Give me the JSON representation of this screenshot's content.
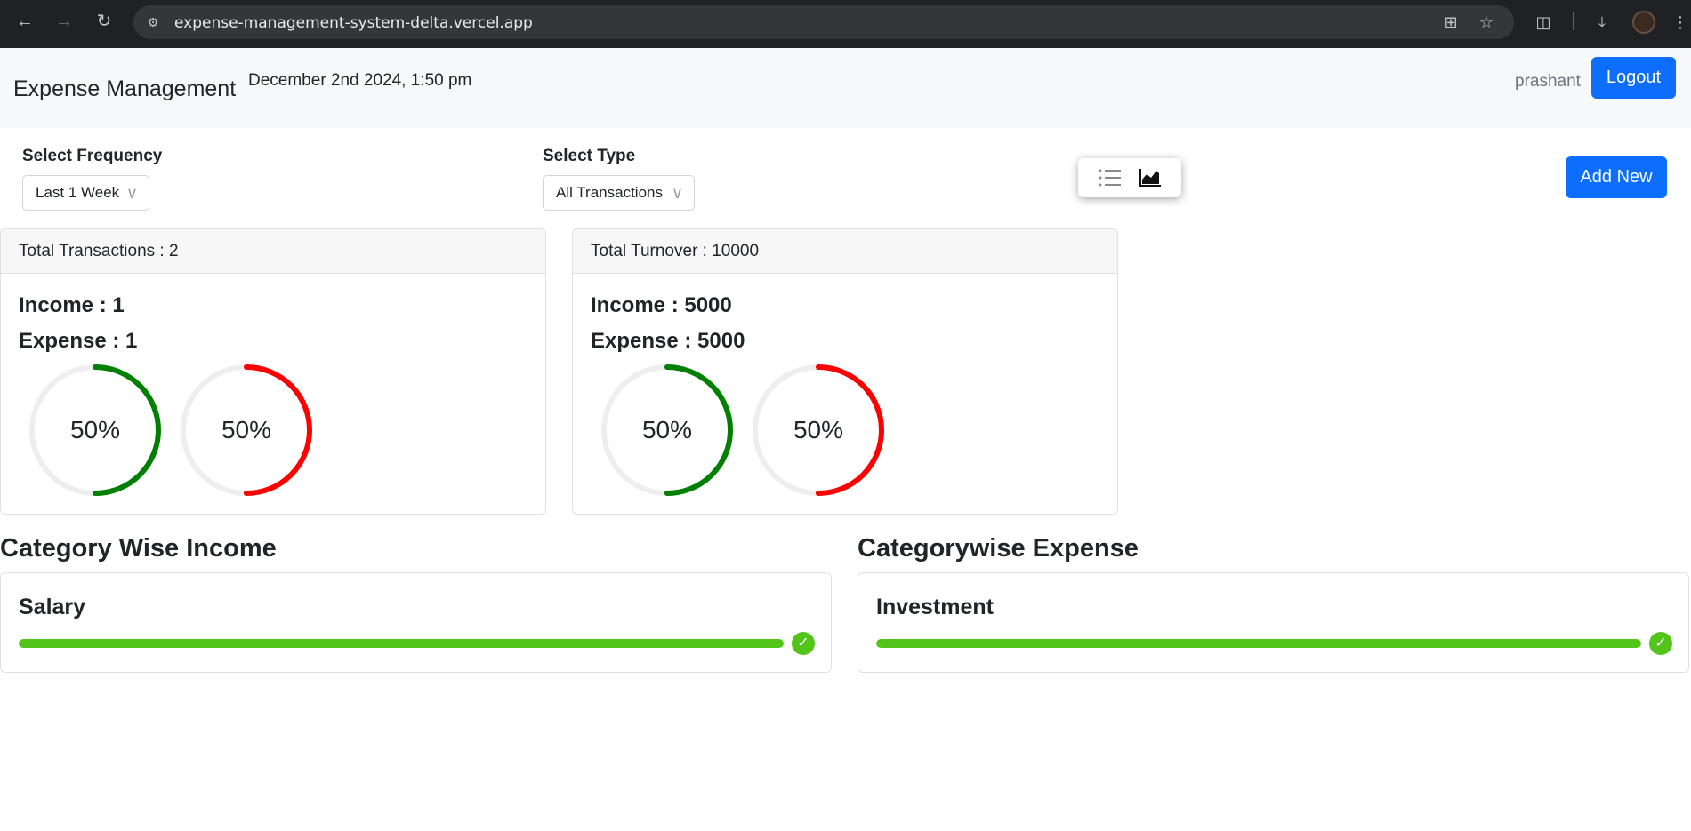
{
  "browser": {
    "url": "expense-management-system-delta.vercel.app",
    "icons": [
      "back-icon",
      "forward-icon",
      "reload-icon",
      "site-settings-icon",
      "install-app-icon",
      "bookmark-star-icon",
      "extensions-icon",
      "download-icon",
      "profile-avatar",
      "more-menu-icon"
    ]
  },
  "header": {
    "brand": "Expense Management",
    "date": "December 2nd 2024, 1:50 pm",
    "username": "prashant",
    "logout_label": "Logout"
  },
  "filters": {
    "frequency_label": "Select Frequency",
    "frequency_value": "Last 1 Week",
    "type_label": "Select Type",
    "type_value": "All Transactions",
    "add_label": "Add New",
    "view_icons": [
      "list-view-icon",
      "chart-view-icon"
    ]
  },
  "summary": {
    "transactions": {
      "header": "Total Transactions : 2",
      "income": "Income : 1",
      "expense": "Expense : 1",
      "income_percent": 50,
      "expense_percent": 50,
      "income_percent_label": "50%",
      "expense_percent_label": "50%"
    },
    "turnover": {
      "header": "Total Turnover : 10000",
      "income": "Income : 5000",
      "expense": "Expense : 5000",
      "income_percent": 50,
      "expense_percent": 50,
      "income_percent_label": "50%",
      "expense_percent_label": "50%"
    }
  },
  "categories": {
    "income_title": "Category Wise Income",
    "expense_title": "Categorywise Expense",
    "income_items": [
      {
        "name": "Salary",
        "percent": 100
      }
    ],
    "expense_items": [
      {
        "name": "Investment",
        "percent": 100
      }
    ]
  },
  "colors": {
    "primary": "#0d6efd",
    "income": "#008000",
    "expense": "#ff0000",
    "progress": "#52c41a",
    "donut_track": "#eeeeee"
  }
}
